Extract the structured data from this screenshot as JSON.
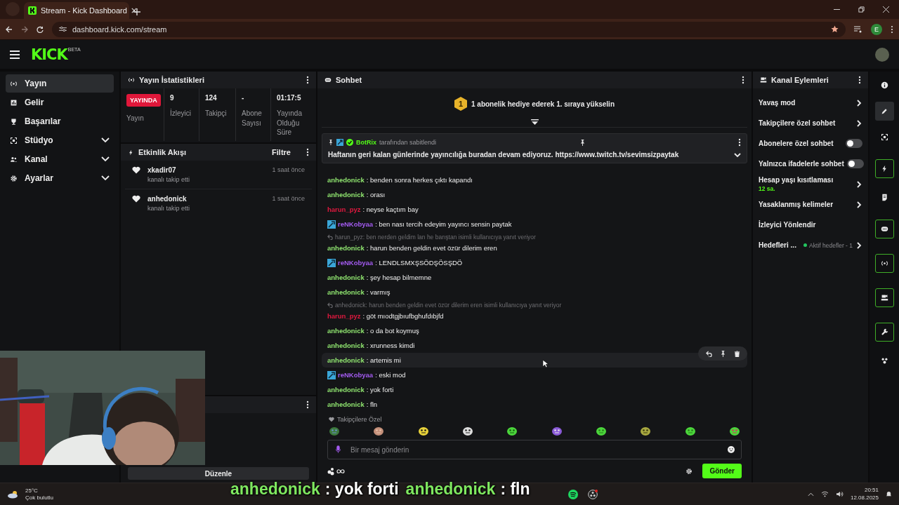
{
  "browser": {
    "tab_title": "Stream - Kick Dashboard",
    "url": "dashboard.kick.com/stream",
    "profile": "E",
    "bookmarked": true
  },
  "header": {
    "logo": "KICK",
    "logo_tag": "BETA"
  },
  "sidebar": {
    "items": [
      {
        "label": "Yayın",
        "selected": true,
        "kind": "link"
      },
      {
        "label": "Gelir",
        "selected": false,
        "kind": "link"
      },
      {
        "label": "Başarılar",
        "selected": false,
        "kind": "link"
      },
      {
        "label": "Stüdyo",
        "selected": false,
        "kind": "group",
        "expanded": false
      },
      {
        "label": "Kanal",
        "selected": false,
        "kind": "group",
        "expanded": false
      },
      {
        "label": "Ayarlar",
        "selected": false,
        "kind": "group",
        "expanded": false
      }
    ]
  },
  "stats": {
    "title": "Yayın İstatistikleri",
    "live_badge": "YAYINDA",
    "live_label": "Yayın",
    "columns": [
      {
        "value": "9",
        "label": "İzleyici"
      },
      {
        "value": "124",
        "label": "Takipçi"
      },
      {
        "value": "-",
        "label": "Abone Sayısı"
      },
      {
        "value": "01:17:5",
        "label": "Yayında Olduğu Süre"
      }
    ]
  },
  "activity": {
    "title": "Etkinlik Akışı",
    "filter": "Filtre",
    "events": [
      {
        "user": "xkadir07",
        "action": "kanalı takip etti",
        "time": "1 saat önce"
      },
      {
        "user": "anhedonick",
        "action": "kanalı takip etti",
        "time": "1 saat önce"
      }
    ]
  },
  "bottom_panel": {
    "button": "Düzenle"
  },
  "chat": {
    "title": "Sohbet",
    "banner": {
      "rank": "1",
      "text": "1 abonelik hediye ederek 1. sıraya yükselin"
    },
    "pinned": {
      "user": "BotRix",
      "by": "tarafından sabitlendi",
      "text": "Haftanın geri kalan günlerinde yayıncılığa buradan devam ediyoruz.",
      "link": "https://www.twitch.tv/sevimsizpaytak"
    },
    "messages": [
      {
        "user": "anhedonick",
        "color": "#8fe46f",
        "badge": false,
        "text": ": benden sonra herkes çıktı kapandı",
        "highlighted": false
      },
      {
        "user": "anhedonick",
        "color": "#8fe46f",
        "badge": false,
        "text": ": orası",
        "highlighted": false
      },
      {
        "user": "harun_pyz",
        "color": "#e0193f",
        "badge": false,
        "text": ": neyse kaçtım bay",
        "highlighted": false
      },
      {
        "user": "reNKobyaa",
        "color": "#a35bf0",
        "badge": true,
        "text": ": ben nası tercih edeyim yayıncı sensin paytak",
        "highlighted": false
      },
      {
        "user": "anhedonick",
        "color": "#8fe46f",
        "badge": false,
        "text": ": harun benden geldin evet özür dilerim eren",
        "highlighted": false,
        "reply": "harun_pyz: ben nerden geldim lan he barıştan isimli kullanıcıya yanıt veriyor"
      },
      {
        "user": "reNKobyaa",
        "color": "#a35bf0",
        "badge": true,
        "text": ": LENDLSMXŞSÖDŞÖSŞDÖ",
        "highlighted": false
      },
      {
        "user": "anhedonick",
        "color": "#8fe46f",
        "badge": false,
        "text": ": şey hesap bilmemne",
        "highlighted": false
      },
      {
        "user": "anhedonick",
        "color": "#8fe46f",
        "badge": false,
        "text": ": varmış",
        "highlighted": false
      },
      {
        "user": "harun_pyz",
        "color": "#e0193f",
        "badge": false,
        "text": ": göt mıodtgjbıufbghufdıbjfd",
        "highlighted": false,
        "reply": "anhedonick: harun benden geldin evet özür dilerim eren isimli kullanıcıya yanıt veriyor"
      },
      {
        "user": "anhedonick",
        "color": "#8fe46f",
        "badge": false,
        "text": ": o da bot koymuş",
        "highlighted": false
      },
      {
        "user": "anhedonick",
        "color": "#8fe46f",
        "badge": false,
        "text": ": xrunness kimdi",
        "highlighted": false
      },
      {
        "user": "anhedonick",
        "color": "#8fe46f",
        "badge": false,
        "text": ": artemis mi",
        "highlighted": true
      },
      {
        "user": "reNKobyaa",
        "color": "#a35bf0",
        "badge": true,
        "text": ": eski mod",
        "highlighted": false
      },
      {
        "user": "anhedonick",
        "color": "#8fe46f",
        "badge": false,
        "text": ": yok forti",
        "highlighted": false
      },
      {
        "user": "anhedonick",
        "color": "#8fe46f",
        "badge": false,
        "text": ": fln",
        "highlighted": false
      }
    ],
    "emote_group": "Takipçilere Özel",
    "placeholder": "Bir mesaj gönderin",
    "send": "Gönder"
  },
  "channel_actions": {
    "title": "Kanal Eylemleri",
    "items": [
      {
        "kind": "link",
        "label": "Yavaş mod"
      },
      {
        "kind": "link",
        "label": "Takipçilere özel sohbet"
      },
      {
        "kind": "toggle",
        "label": "Abonelere özel sohbet",
        "on": false
      },
      {
        "kind": "toggle",
        "label": "Yalnızca ifadelerle sohbet",
        "on": false
      },
      {
        "kind": "link",
        "label": "Hesap yaşı kısıtlaması",
        "detail": "12 sa."
      },
      {
        "kind": "link",
        "label": "Yasaklanmış kelimeler"
      },
      {
        "kind": "plain",
        "label": "İzleyici Yönlendir"
      },
      {
        "kind": "link",
        "label": "Hedefleri ...",
        "status": "Aktif hedefler - 1"
      }
    ]
  },
  "rail": [
    {
      "selected": false,
      "pinned": false
    },
    {
      "selected": true,
      "pinned": false
    },
    {
      "selected": false,
      "pinned": false
    },
    {
      "selected": false,
      "pinned": true
    },
    {
      "selected": false,
      "pinned": false
    },
    {
      "selected": false,
      "pinned": true
    },
    {
      "selected": false,
      "pinned": true
    },
    {
      "selected": false,
      "pinned": true
    },
    {
      "selected": false,
      "pinned": true
    },
    {
      "selected": false,
      "pinned": false
    }
  ],
  "taskbar": {
    "temperature": "25°C",
    "weather": "Çok bulutlu",
    "time": "20:51",
    "date": "12.08.2025"
  },
  "overlay_subtitles": [
    {
      "user": "anhedonick",
      "text": ": yok forti"
    },
    {
      "user": "anhedonick",
      "text": ": fln"
    }
  ]
}
